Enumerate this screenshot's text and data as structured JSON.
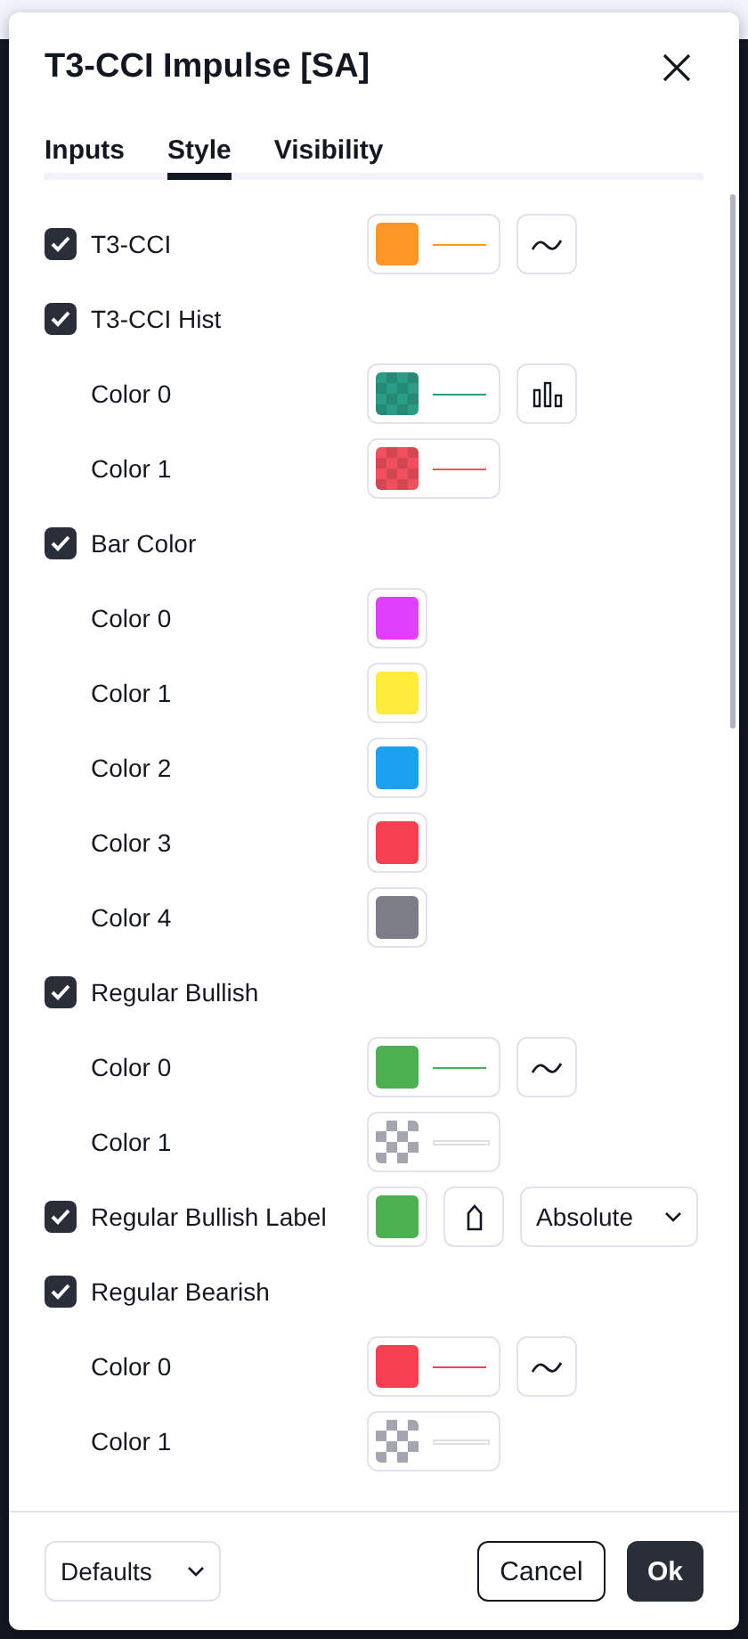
{
  "dialog": {
    "title": "T3-CCI Impulse [SA]"
  },
  "tabs": [
    {
      "label": "Inputs",
      "selected": false
    },
    {
      "label": "Style",
      "selected": true
    },
    {
      "label": "Visibility",
      "selected": false
    }
  ],
  "rows": [
    {
      "kind": "group",
      "label": "T3-CCI",
      "checked": true,
      "swatch": {
        "kind": "solid",
        "color": "#ff9526",
        "line": true
      },
      "style_button": {
        "kind": "line"
      }
    },
    {
      "kind": "group",
      "label": "T3-CCI Hist",
      "checked": true
    },
    {
      "kind": "color",
      "label": "Color 0",
      "swatch": {
        "kind": "checker",
        "color": "#2a9d84",
        "line": true
      },
      "style_button": {
        "kind": "columns"
      }
    },
    {
      "kind": "color",
      "label": "Color 1",
      "swatch": {
        "kind": "checker",
        "color": "#f0505e",
        "line": true
      }
    },
    {
      "kind": "group",
      "label": "Bar Color",
      "checked": true
    },
    {
      "kind": "color",
      "label": "Color 0",
      "swatch": {
        "kind": "solid",
        "color": "#e040fb"
      }
    },
    {
      "kind": "color",
      "label": "Color 1",
      "swatch": {
        "kind": "solid",
        "color": "#ffeb3b"
      }
    },
    {
      "kind": "color",
      "label": "Color 2",
      "swatch": {
        "kind": "solid",
        "color": "#1ca0f2"
      }
    },
    {
      "kind": "color",
      "label": "Color 3",
      "swatch": {
        "kind": "solid",
        "color": "#f7404f"
      }
    },
    {
      "kind": "color",
      "label": "Color 4",
      "swatch": {
        "kind": "solid",
        "color": "#7c7e87"
      }
    },
    {
      "kind": "group",
      "label": "Regular Bullish",
      "checked": true
    },
    {
      "kind": "color",
      "label": "Color 0",
      "swatch": {
        "kind": "solid",
        "color": "#4caf50",
        "line": true
      },
      "style_button": {
        "kind": "line"
      }
    },
    {
      "kind": "color",
      "label": "Color 1",
      "swatch": {
        "kind": "empty",
        "line": true
      }
    },
    {
      "kind": "group",
      "label": "Regular Bullish Label",
      "checked": true,
      "swatch": {
        "kind": "solid",
        "color": "#4caf50"
      },
      "shape_button": {
        "kind": "label"
      },
      "select": "Absolute"
    },
    {
      "kind": "group",
      "label": "Regular Bearish",
      "checked": true
    },
    {
      "kind": "color",
      "label": "Color 0",
      "swatch": {
        "kind": "solid",
        "color": "#f7404f",
        "line": true
      },
      "style_button": {
        "kind": "line"
      }
    },
    {
      "kind": "color",
      "label": "Color 1",
      "swatch": {
        "kind": "empty",
        "line": true
      }
    }
  ],
  "footer": {
    "defaults": "Defaults",
    "cancel": "Cancel",
    "ok": "Ok"
  }
}
